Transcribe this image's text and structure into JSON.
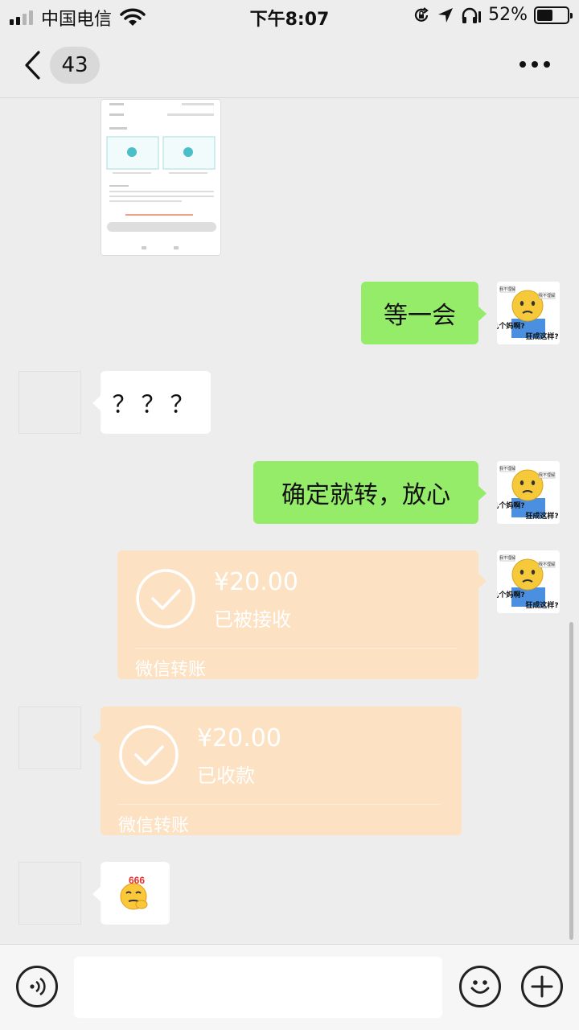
{
  "status_bar": {
    "carrier": "中国电信",
    "time": "下午8:07",
    "battery": "52%",
    "battery_level": 0.52
  },
  "nav": {
    "unread_count": "43"
  },
  "messages": {
    "m1_text": "等一会",
    "m2_text": "？？？",
    "m3_text": "确定就转，放心",
    "transfer_sent": {
      "amount": "¥20.00",
      "status": "已被接收",
      "label": "微信转账"
    },
    "transfer_recv": {
      "amount": "¥20.00",
      "status": "已收款",
      "label": "微信转账"
    },
    "sticker_text": "666"
  },
  "avatar_sticker": {
    "top": "我不理解",
    "top2": "我不理解",
    "left": "几个妈啊?",
    "right": "狂成这样?"
  },
  "colors": {
    "green_bubble": "#95ec69",
    "transfer_bg": "#fce1c3",
    "chat_bg": "#ededed"
  }
}
